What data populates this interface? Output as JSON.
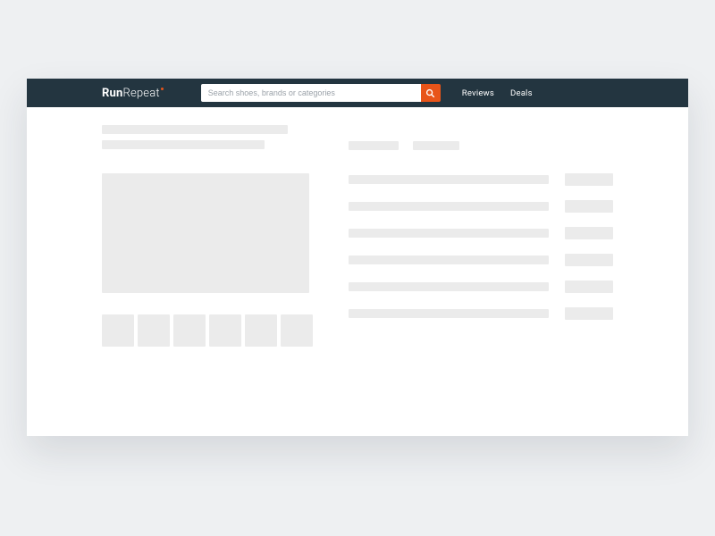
{
  "brand": {
    "part1": "Run",
    "part2": "Repeat"
  },
  "search": {
    "placeholder": "Search shoes, brands or categories"
  },
  "nav": {
    "reviews": "Reviews",
    "deals": "Deals"
  },
  "colors": {
    "navbar": "#233540",
    "accent": "#e85419",
    "skeleton": "#ebebeb",
    "page_bg": "#eef0f2"
  }
}
